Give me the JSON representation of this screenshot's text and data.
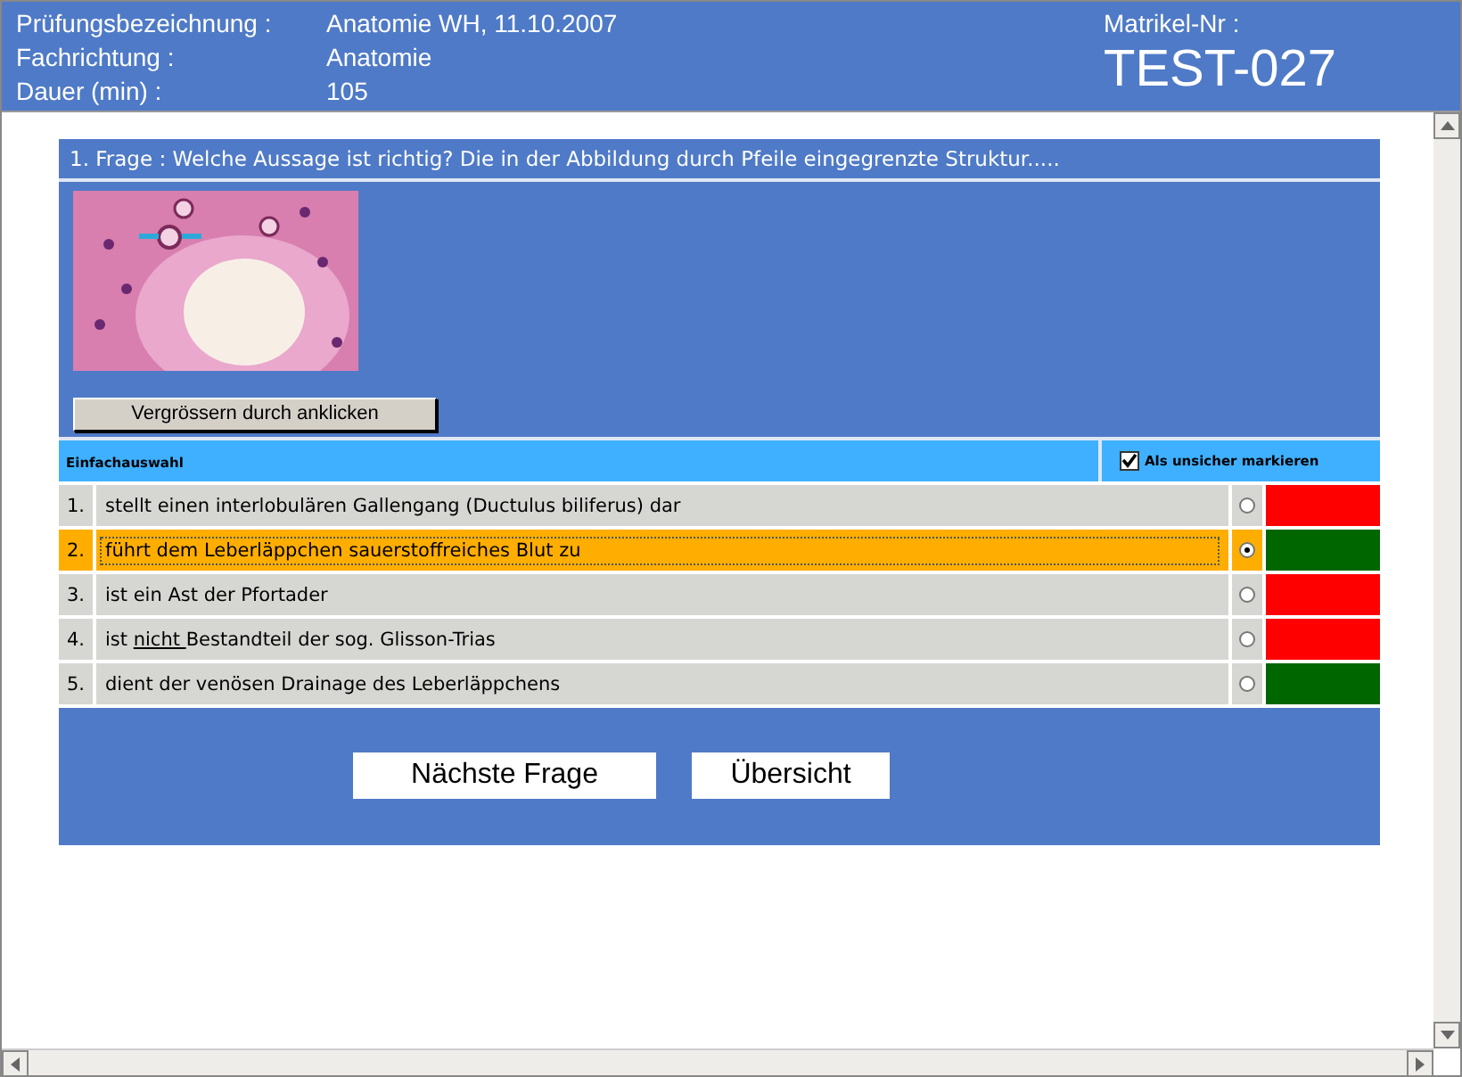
{
  "header": {
    "fields": [
      {
        "label": "Prüfungsbezeichnung :",
        "value": "Anatomie WH, 11.10.2007"
      },
      {
        "label": "Fachrichtung :",
        "value": "Anatomie"
      },
      {
        "label": "Dauer (min) :",
        "value": "105"
      }
    ],
    "id_label": "Matrikel-Nr :",
    "id_value": "TEST-027"
  },
  "question": {
    "title": "1. Frage : Welche Aussage ist richtig? Die in der Abbildung durch Pfeile eingegrenzte Struktur.....",
    "image": {
      "kind": "picture"
    },
    "enlarge_button": "Vergrössern durch anklicken",
    "mode": "Einfachauswahl",
    "unsure": {
      "label": "Als unsicher markieren",
      "checked": true
    },
    "answers": [
      {
        "number": "1.",
        "segments": [
          {
            "text": "stellt einen interlobulären Gallengang (Ductulus biliferus) dar",
            "underlined": false
          }
        ],
        "selected": false,
        "color": "#ff0000"
      },
      {
        "number": "2.",
        "segments": [
          {
            "text": "führt dem Leberläppchen sauerstoffreiches Blut zu",
            "underlined": false
          }
        ],
        "selected": true,
        "color": "#006600"
      },
      {
        "number": "3.",
        "segments": [
          {
            "text": "ist ein Ast der Pfortader",
            "underlined": false
          }
        ],
        "selected": false,
        "color": "#ff0000"
      },
      {
        "number": "4.",
        "segments": [
          {
            "text": "ist ",
            "underlined": false
          },
          {
            "text": "nicht ",
            "underlined": true
          },
          {
            "text": "Bestandteil der sog. Glisson-Trias",
            "underlined": false
          }
        ],
        "selected": false,
        "color": "#ff0000"
      },
      {
        "number": "5.",
        "segments": [
          {
            "text": "dient der venösen Drainage des Leberläppchens",
            "underlined": false
          }
        ],
        "selected": false,
        "color": "#006600"
      }
    ],
    "buttons": [
      "Nächste Frage",
      "Übersicht"
    ]
  }
}
